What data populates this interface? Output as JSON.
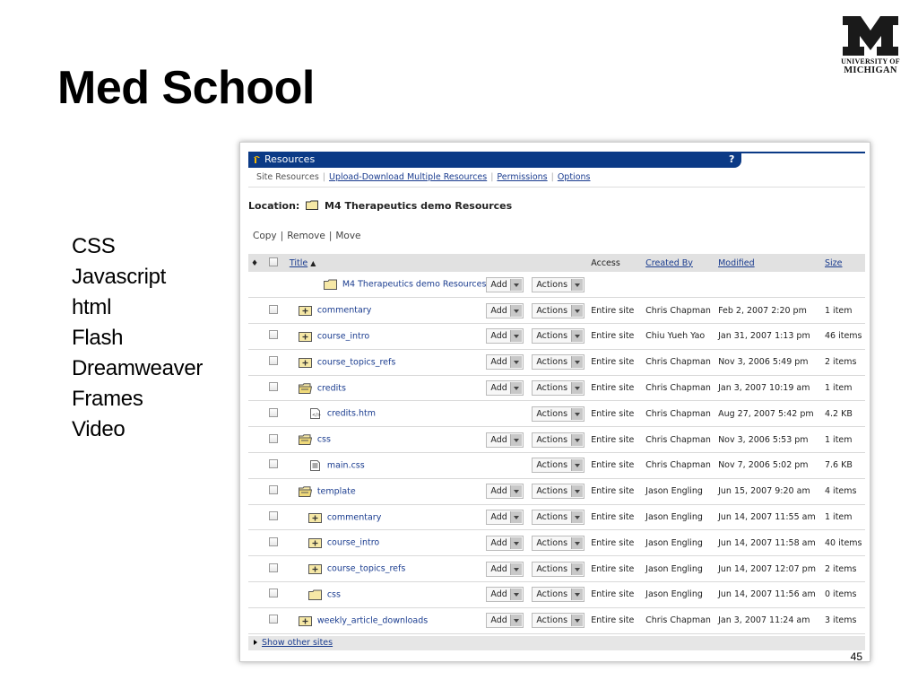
{
  "slide": {
    "title": "Med School",
    "bullets": [
      "CSS",
      "Javascript",
      "html",
      "Flash",
      "Dreamweaver",
      "Frames",
      "Video"
    ],
    "page_number": "45",
    "logo": {
      "line1": "UNIVERSITY OF",
      "line2": "MICHIGAN",
      "color": "#111111",
      "glyph": "M"
    }
  },
  "resources": {
    "tab_title": "Resources",
    "help": "?",
    "subnav": {
      "site_resources": "Site Resources",
      "upload": "Upload-Download Multiple Resources",
      "permissions": "Permissions",
      "options": "Options"
    },
    "location_label": "Location:",
    "location_value": "M4 Therapeutics demo Resources",
    "ops": {
      "copy": "Copy",
      "remove": "Remove",
      "move": "Move"
    },
    "columns": {
      "title": "Title",
      "access": "Access",
      "created_by": "Created By",
      "modified": "Modified",
      "size": "Size"
    },
    "button_add": "Add",
    "button_actions": "Actions",
    "root_folder": "M4 Therapeutics demo Resources",
    "rows": [
      {
        "name": "commentary",
        "icon": "folder-plus-icon",
        "indent": 0,
        "add": true,
        "access": "Entire site",
        "by": "Chris Chapman",
        "modified": "Feb 2, 2007 2:20 pm",
        "size": "1 item"
      },
      {
        "name": "course_intro",
        "icon": "folder-plus-icon",
        "indent": 0,
        "add": true,
        "access": "Entire site",
        "by": "Chiu Yueh Yao",
        "modified": "Jan 31, 2007 1:13 pm",
        "size": "46 items"
      },
      {
        "name": "course_topics_refs",
        "icon": "folder-plus-icon",
        "indent": 0,
        "add": true,
        "access": "Entire site",
        "by": "Chris Chapman",
        "modified": "Nov 3, 2006 5:49 pm",
        "size": "2 items"
      },
      {
        "name": "credits",
        "icon": "folder-open-icon",
        "indent": 0,
        "add": true,
        "access": "Entire site",
        "by": "Chris Chapman",
        "modified": "Jan 3, 2007 10:19 am",
        "size": "1 item"
      },
      {
        "name": "credits.htm",
        "icon": "html-file-icon",
        "indent": 1,
        "add": false,
        "access": "Entire site",
        "by": "Chris Chapman",
        "modified": "Aug 27, 2007 5:42 pm",
        "size": "4.2 KB"
      },
      {
        "name": "css",
        "icon": "folder-open-icon",
        "indent": 0,
        "add": true,
        "access": "Entire site",
        "by": "Chris Chapman",
        "modified": "Nov 3, 2006 5:53 pm",
        "size": "1 item"
      },
      {
        "name": "main.css",
        "icon": "text-file-icon",
        "indent": 1,
        "add": false,
        "access": "Entire site",
        "by": "Chris Chapman",
        "modified": "Nov 7, 2006 5:02 pm",
        "size": "7.6 KB"
      },
      {
        "name": "template",
        "icon": "folder-open-icon",
        "indent": 0,
        "add": true,
        "access": "Entire site",
        "by": "Jason Engling",
        "modified": "Jun 15, 2007 9:20 am",
        "size": "4 items"
      },
      {
        "name": "commentary",
        "icon": "folder-plus-icon",
        "indent": 1,
        "add": true,
        "access": "Entire site",
        "by": "Jason Engling",
        "modified": "Jun 14, 2007 11:55 am",
        "size": "1 item"
      },
      {
        "name": "course_intro",
        "icon": "folder-plus-icon",
        "indent": 1,
        "add": true,
        "access": "Entire site",
        "by": "Jason Engling",
        "modified": "Jun 14, 2007 11:58 am",
        "size": "40 items"
      },
      {
        "name": "course_topics_refs",
        "icon": "folder-plus-icon",
        "indent": 1,
        "add": true,
        "access": "Entire site",
        "by": "Jason Engling",
        "modified": "Jun 14, 2007 12:07 pm",
        "size": "2 items"
      },
      {
        "name": "css",
        "icon": "folder-icon",
        "indent": 1,
        "add": true,
        "access": "Entire site",
        "by": "Jason Engling",
        "modified": "Jun 14, 2007 11:56 am",
        "size": "0 items"
      },
      {
        "name": "weekly_article_downloads",
        "icon": "folder-plus-icon",
        "indent": 0,
        "add": true,
        "access": "Entire site",
        "by": "Chris Chapman",
        "modified": "Jan 3, 2007 11:24 am",
        "size": "3 items"
      }
    ],
    "footer_link": "Show other sites"
  }
}
